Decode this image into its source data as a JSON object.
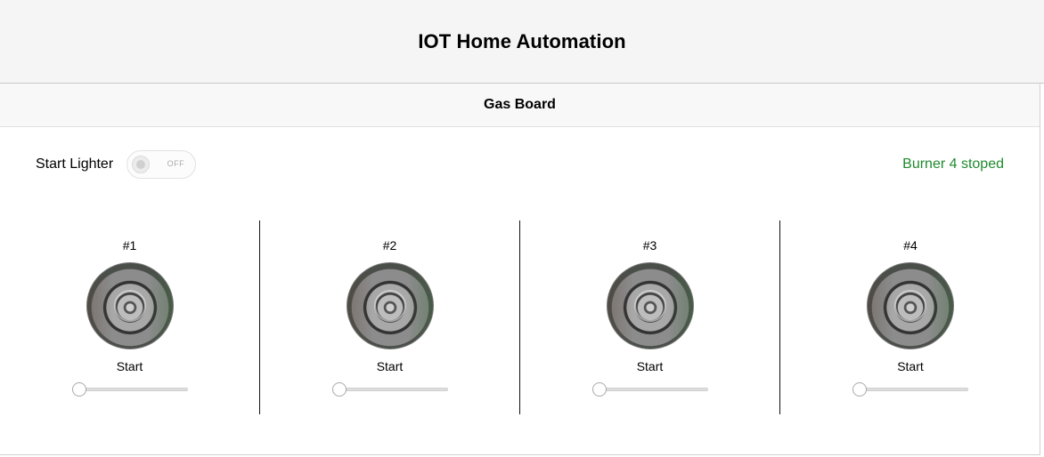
{
  "app": {
    "title": "IOT Home Automation"
  },
  "panel": {
    "title": "Gas Board"
  },
  "lighter": {
    "label": "Start Lighter",
    "toggle_text": "OFF",
    "on": false
  },
  "status": {
    "text": "Burner 4 stoped",
    "color": "#1f8a2e"
  },
  "burners": [
    {
      "number": "#1",
      "action_label": "Start",
      "level": 0
    },
    {
      "number": "#2",
      "action_label": "Start",
      "level": 0
    },
    {
      "number": "#3",
      "action_label": "Start",
      "level": 0
    },
    {
      "number": "#4",
      "action_label": "Start",
      "level": 0
    }
  ]
}
